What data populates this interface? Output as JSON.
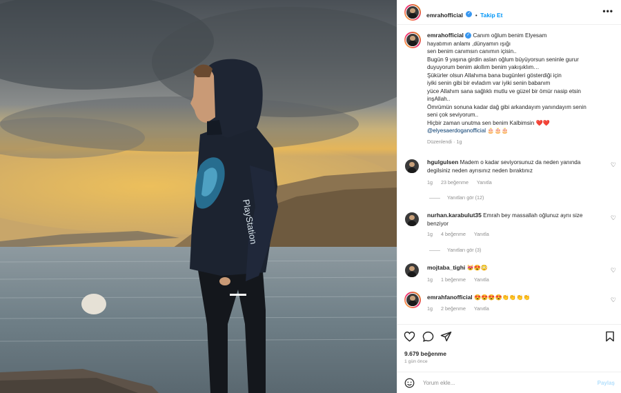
{
  "post": {
    "username": "emrahofficial",
    "dot": "•",
    "follow_label": "Takip Et",
    "more_label": "•••"
  },
  "caption": {
    "username": "emrahofficial",
    "lines": [
      "Canım oğlum benim Elyesam",
      "hayatımın anlamı ,dünyamın ışığı",
      "sen benim canımsın canımın içisin..",
      "Bugün 9 yaşına girdin aslan oğlum büyüyorsun seninle gurur",
      "duyuyorum benim akıllım benim yakışıklım…",
      "Şükürler olsun Allahıma bana bugünleri gösterdiği için",
      "iyiki senin gibi bir evladım var iyiki senin babanım",
      "yüce Allahım sana sağlıklı mutlu ve güzel bir ömür nasip etsin",
      "inşAllah..",
      "Ömrümün sonuna kadar dağ gibi arkandayım yanındayım senin",
      "seni çok seviyorum..",
      "Hiçbir zaman unutma sen benim Kalbimsin ❤️❤️"
    ],
    "mention": "@elyesaerdoganofficial",
    "mention_emoji": "🎂🎂🎂",
    "meta": "Düzenlendi · 1g"
  },
  "comments": [
    {
      "username": "hgulgulsen",
      "text_lines": [
        "Madem o kadar seviyorsunuz da neden yanında",
        "degilsiniz neden ayrısınız neden bıraktınız"
      ],
      "time": "1g",
      "likes": "23 beğenme",
      "reply": "Yanıtla",
      "view_replies": "Yanıtları gör (12)"
    },
    {
      "username": "nurhan.karabulut35",
      "text_lines": [
        "Emrah bey massallah oğlunuz aynı size",
        "benziyor"
      ],
      "time": "1g",
      "likes": "4 beğenme",
      "reply": "Yanıtla",
      "view_replies": "Yanıtları gör (3)"
    },
    {
      "username": "mojtaba_tighi",
      "text_lines": [
        "😻😍😳"
      ],
      "time": "1g",
      "likes": "1 beğenme",
      "reply": "Yanıtla"
    },
    {
      "username": "emrahfanofficial",
      "text_lines": [
        "😍😍😍😍👏👏👏👏"
      ],
      "time": "1g",
      "likes": "2 beğenme",
      "reply": "Yanıtla"
    }
  ],
  "footer": {
    "likes": "9.679 beğenme",
    "ago": "1 gün önce",
    "comment_placeholder": "Yorum ekle...",
    "post_label": "Paylaş"
  },
  "photo": {
    "hoodie_text": "PlayStation"
  },
  "colors": {
    "accent": "#0095f6",
    "heart": "#ed4956",
    "muted": "#8e8e8e"
  }
}
